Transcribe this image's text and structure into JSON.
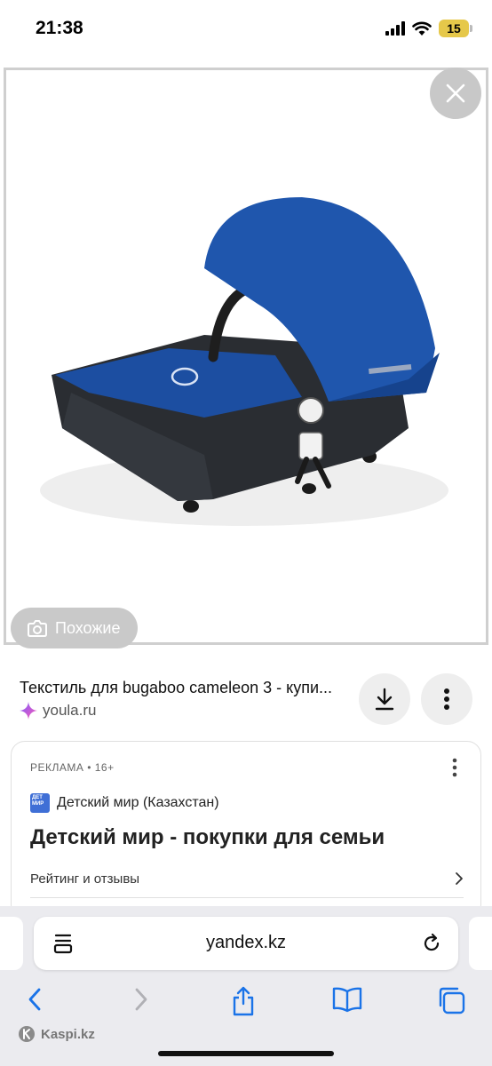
{
  "status_bar": {
    "time": "21:38",
    "battery": "15"
  },
  "viewer": {
    "similar_label": "Похожие"
  },
  "result": {
    "title": "Текстиль для bugaboo cameleon 3 - купи...",
    "source": "youla.ru"
  },
  "ad": {
    "label": "РЕКЛАМА • 16+",
    "brand": "Детский мир (Казахстан)",
    "title": "Детский мир - покупки для семьи",
    "link": "Рейтинг и отзывы"
  },
  "browser": {
    "url": "yandex.kz"
  },
  "watermark": "Kaspi.kz",
  "colors": {
    "accent": "#1a73e8",
    "canopy_blue": "#1c4ea1",
    "frame_dark": "#2a2d32"
  }
}
